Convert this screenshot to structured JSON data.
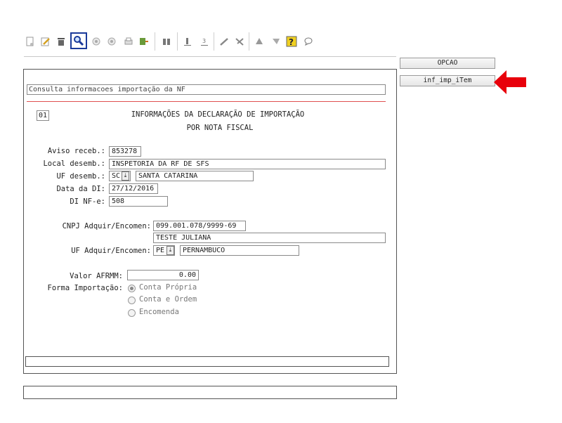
{
  "toolbar": {
    "icons": [
      "new-doc-icon",
      "edit-icon",
      "delete-icon",
      "search-icon",
      "prev-icon",
      "next-icon",
      "print-icon",
      "export-icon",
      "binoculars-icon",
      "first-icon",
      "last-icon",
      "confirm-icon",
      "cancel-icon",
      "up-icon",
      "filter-icon",
      "help-icon",
      "chat-icon"
    ]
  },
  "side": {
    "opcao_label": "OPCAO",
    "item_label": "inf_imp_iTem",
    "arrow_color": "#e8000b"
  },
  "form": {
    "title": "Consulta informacoes importação da NF",
    "page_number": "01",
    "heading_line1": "INFORMAÇÕES DA DECLARAÇÃO DE IMPORTAÇÃO",
    "heading_line2": "POR NOTA FISCAL",
    "aviso_label": "Aviso receb.:",
    "aviso_value": "853278",
    "local_label": "Local desemb.:",
    "local_value": "INSPETORIA DA RF DE SFS",
    "uf_desemb_label": "UF desemb.:",
    "uf_desemb_value": "SC",
    "uf_desemb_name": "SANTA CATARINA",
    "data_di_label": "Data da DI:",
    "data_di_value": "27/12/2016",
    "di_nfe_label": "DI NF-e:",
    "di_nfe_value": "508",
    "cnpj_label": "CNPJ Adquir/Encomen:",
    "cnpj_value": "099.001.078/9999-69",
    "adquir_name": "TESTE JULIANA",
    "uf_adquir_label": "UF Adquir/Encomen:",
    "uf_adquir_value": "PE",
    "uf_adquir_name": "PERNAMBUCO",
    "afrmm_label": "Valor AFRMM:",
    "afrmm_value": "0.00",
    "forma_label": "Forma Importação:",
    "forma_options": [
      "Conta Própria",
      "Conta e Ordem",
      "Encomenda"
    ]
  }
}
